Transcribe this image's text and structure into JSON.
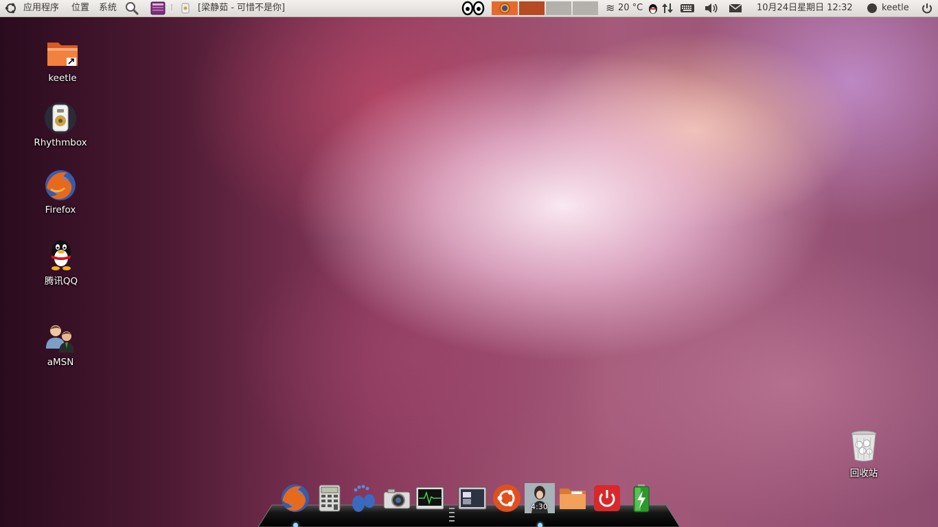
{
  "panel": {
    "menu": {
      "apps": "应用程序",
      "places": "位置",
      "system": "系统"
    },
    "task_title": "[梁静茹 - 可惜不是你]",
    "weather": "20 °C",
    "datetime": "10月24日星期日 12:32",
    "user": "keetle"
  },
  "desktop": {
    "icons": [
      {
        "label": "keetle",
        "icon": "home-folder-icon"
      },
      {
        "label": "Rhythmbox",
        "icon": "rhythmbox-icon"
      },
      {
        "label": "Firefox",
        "icon": "firefox-icon"
      },
      {
        "label": "腾讯QQ",
        "icon": "qq-penguin-icon"
      },
      {
        "label": "aMSN",
        "icon": "amsn-icon"
      },
      {
        "label": "回收站",
        "icon": "trash-icon"
      }
    ]
  },
  "dock": {
    "items": [
      "firefox-icon",
      "calculator-icon",
      "gnome-foot-icon",
      "camera-icon",
      "system-monitor-icon",
      "terminal-icon",
      "ubuntu-icon",
      "album-cover-icon",
      "file-manager-icon",
      "power-icon",
      "battery-icon"
    ],
    "album_time": "4:30"
  },
  "colors": {
    "panel_bg": "#e6e4df",
    "accent_orange": "#e8692c",
    "text": "#3c3b37"
  }
}
